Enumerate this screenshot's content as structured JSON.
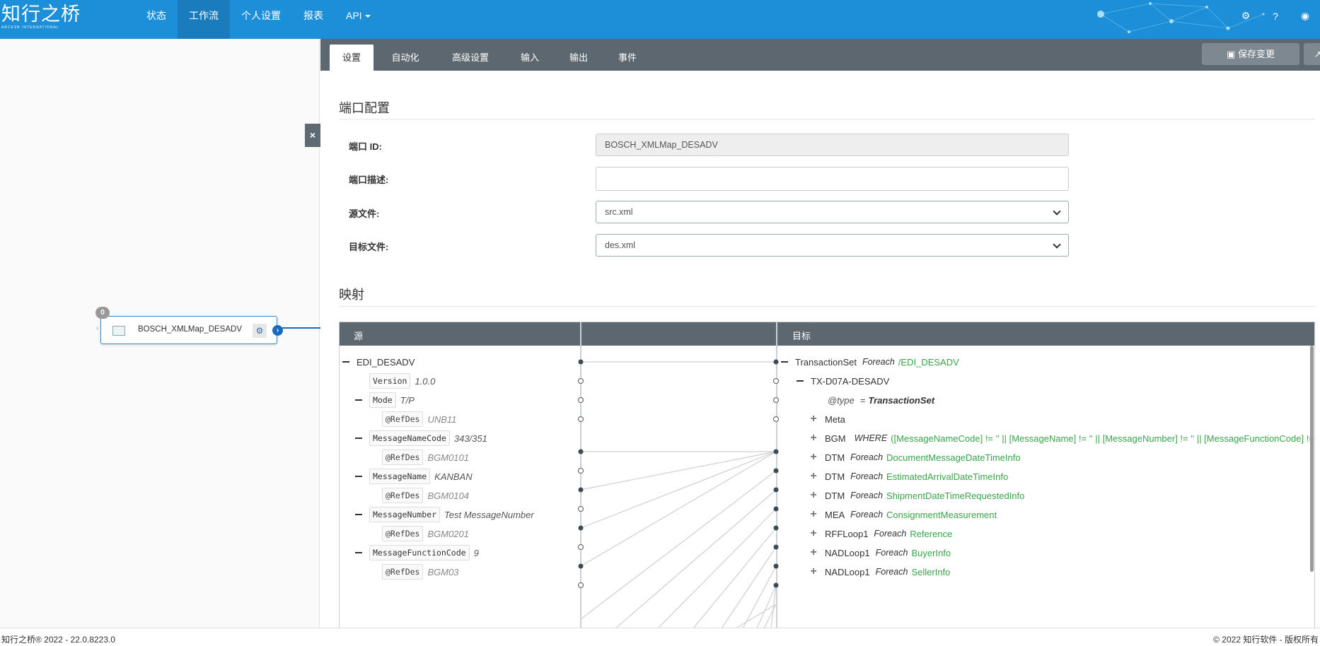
{
  "brand": {
    "name": "知行之桥",
    "sub": "ARCESB INTERNATIONAL"
  },
  "nav": [
    {
      "label": "状态"
    },
    {
      "label": "工作流"
    },
    {
      "label": "个人设置"
    },
    {
      "label": "报表"
    },
    {
      "label": "API"
    }
  ],
  "node": {
    "badge": "0",
    "label": "BOSCH_XMLMap_DESADV"
  },
  "close_label": "×",
  "tabs": [
    "设置",
    "自动化",
    "高级设置",
    "输入",
    "输出",
    "事件"
  ],
  "save_label": "保存变更",
  "port_config": {
    "title": "端口配置",
    "id_label": "端口 ID:",
    "id_value": "BOSCH_XMLMap_DESADV",
    "desc_label": "端口描述:",
    "desc_value": "",
    "src_label": "源文件:",
    "src_value": "src.xml",
    "tgt_label": "目标文件:",
    "tgt_value": "des.xml"
  },
  "mapping": {
    "title": "映射",
    "src_header": "源",
    "tgt_header": "目标",
    "source": {
      "root": "EDI_DESADV",
      "version_tag": "Version",
      "version_val": "1.0.0",
      "mode_tag": "Mode",
      "mode_val": "T/P",
      "refdes": "@RefDes",
      "mode_ref": "UNB11",
      "mnc_tag": "MessageNameCode",
      "mnc_val": "343/351",
      "mnc_ref": "BGM0101",
      "mn_tag": "MessageName",
      "mn_val": "KANBAN",
      "mn_ref": "BGM0104",
      "mnum_tag": "MessageNumber",
      "mnum_val": "Test MessageNumber",
      "mnum_ref": "BGM0201",
      "mfc_tag": "MessageFunctionCode",
      "mfc_val": "9",
      "mfc_ref": "BGM03"
    },
    "target": {
      "ts_name": "TransactionSet",
      "foreach": "Foreach",
      "ts_path": "/EDI_DESADV",
      "tx": "TX-D07A-DESADV",
      "type_attr": "@type",
      "type_eq": "=",
      "type_val": "TransactionSet",
      "meta": "Meta",
      "bgm": "BGM",
      "where": "WHERE",
      "bgm_cond": "([MessageNameCode] != '' || [MessageName] != '' || [MessageNumber] != '' || [MessageFunctionCode] != '')",
      "dtm": "DTM",
      "dtm1": "DocumentMessageDateTimeInfo",
      "dtm2": "EstimatedArrivalDateTimeInfo",
      "dtm3": "ShipmentDateTimeRequestedInfo",
      "mea": "MEA",
      "mea_path": "ConsignmentMeasurement",
      "rff": "RFFLoop1",
      "rff_path": "Reference",
      "nad": "NADLoop1",
      "nad1_path": "BuyerInfo",
      "nad2_path": "SellerInfo"
    }
  },
  "footer": {
    "left": "知行之桥® 2022 - 22.0.8223.0",
    "right": "© 2022 知行软件 - 版权所有"
  },
  "colors": {
    "nav": "#1d8fd8",
    "nav_active": "#1a7bbd",
    "panel_bar": "#5c676f",
    "path_green": "#3aa34a",
    "node_blue": "#1a6ac0"
  }
}
